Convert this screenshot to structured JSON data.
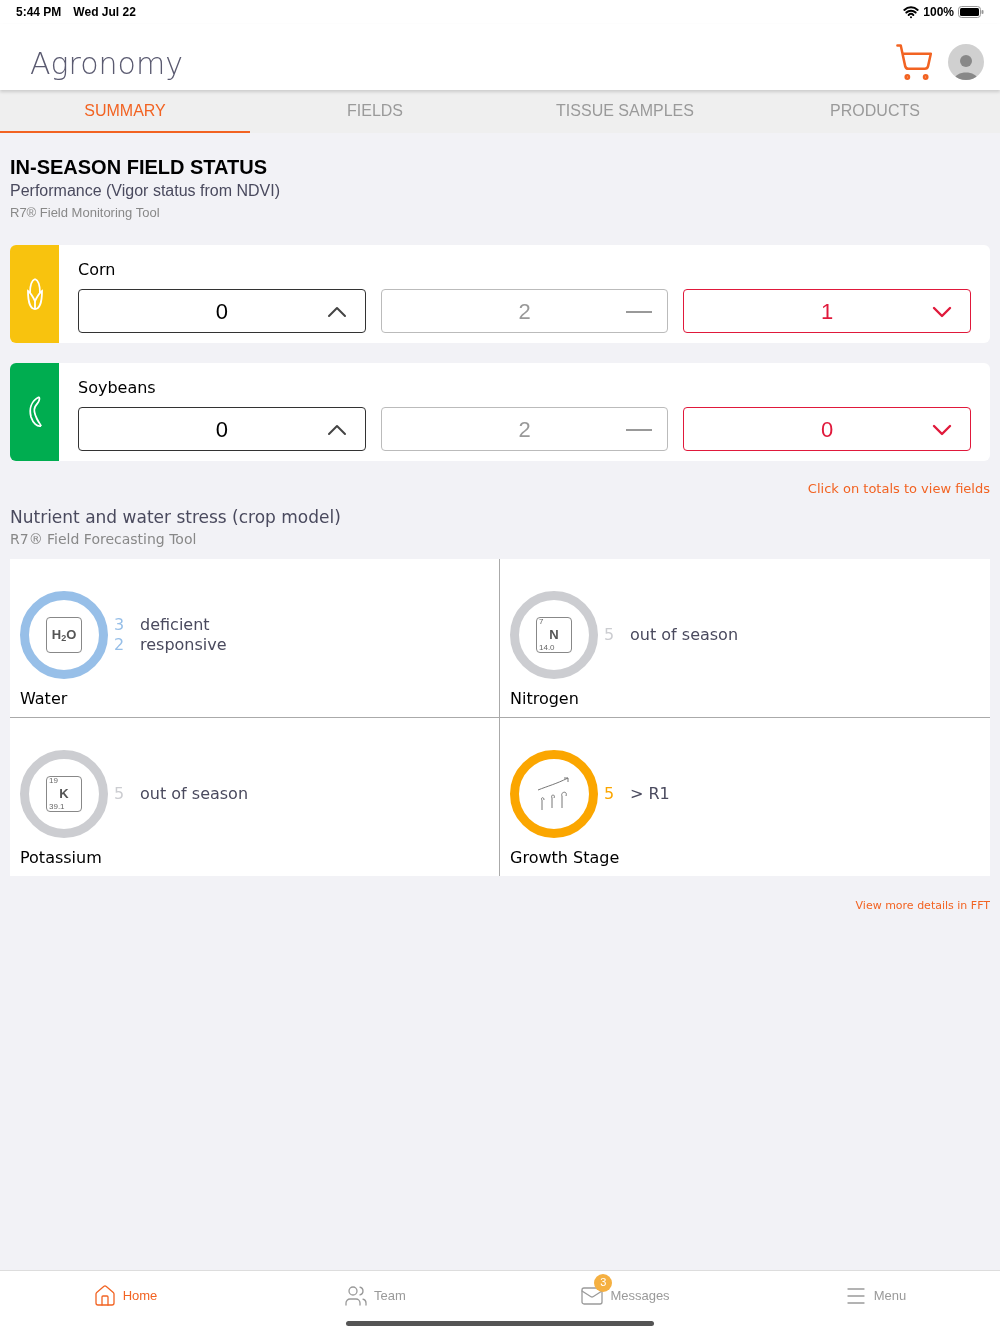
{
  "status_bar": {
    "time": "5:44 PM",
    "date": "Wed Jul 22",
    "battery": "100%"
  },
  "header": {
    "title": "Agronomy"
  },
  "tabs": [
    {
      "label": "SUMMARY",
      "selected": true
    },
    {
      "label": "FIELDS",
      "selected": false
    },
    {
      "label": "TISSUE SAMPLES",
      "selected": false
    },
    {
      "label": "PRODUCTS",
      "selected": false
    }
  ],
  "field_status": {
    "title": "IN-SEASON FIELD STATUS",
    "subtitle": "Performance (Vigor status from NDVI)",
    "tool": "R7® Field Monitoring Tool",
    "crops": [
      {
        "name": "Corn",
        "kind": "corn",
        "color": "#f8c30e",
        "totals": [
          {
            "kind": "up",
            "value": "0"
          },
          {
            "kind": "steady",
            "value": "2"
          },
          {
            "kind": "down",
            "value": "1"
          }
        ]
      },
      {
        "name": "Soybeans",
        "kind": "soybean",
        "color": "#00ad50",
        "totals": [
          {
            "kind": "up",
            "value": "0"
          },
          {
            "kind": "steady",
            "value": "2"
          },
          {
            "kind": "down",
            "value": "0"
          }
        ]
      }
    ],
    "hint": "Click on totals to view fields"
  },
  "stress": {
    "title": "Nutrient and water stress (crop model)",
    "tool": "R7® Field Forecasting Tool",
    "items": [
      {
        "name": "Water",
        "kind": "water",
        "color": "#97bfe8",
        "element": {
          "symbol": "H",
          "sub": "2",
          "symbol2": "O"
        },
        "counts": [
          {
            "count": "3",
            "label": "deficient"
          },
          {
            "count": "2",
            "label": "responsive"
          }
        ]
      },
      {
        "name": "Nitrogen",
        "kind": "element",
        "color": "#cccdd1",
        "element": {
          "number": "7",
          "symbol": "N",
          "mass": "14.0"
        },
        "counts": [
          {
            "count": "5",
            "label": "out of season"
          }
        ]
      },
      {
        "name": "Potassium",
        "kind": "element",
        "color": "#cccdd1",
        "element": {
          "number": "19",
          "symbol": "K",
          "mass": "39.1"
        },
        "counts": [
          {
            "count": "5",
            "label": "out of season"
          }
        ]
      },
      {
        "name": "Growth Stage",
        "kind": "growth",
        "color": "#fba600",
        "counts": [
          {
            "count": "5",
            "label": "> R1"
          }
        ]
      }
    ],
    "link": "View more details in FFT"
  },
  "bottom_nav": [
    {
      "label": "Home",
      "kind": "home",
      "selected": true
    },
    {
      "label": "Team",
      "kind": "team",
      "selected": false
    },
    {
      "label": "Messages",
      "kind": "messages",
      "selected": false,
      "badge": "3"
    },
    {
      "label": "Menu",
      "kind": "menu",
      "selected": false
    }
  ]
}
